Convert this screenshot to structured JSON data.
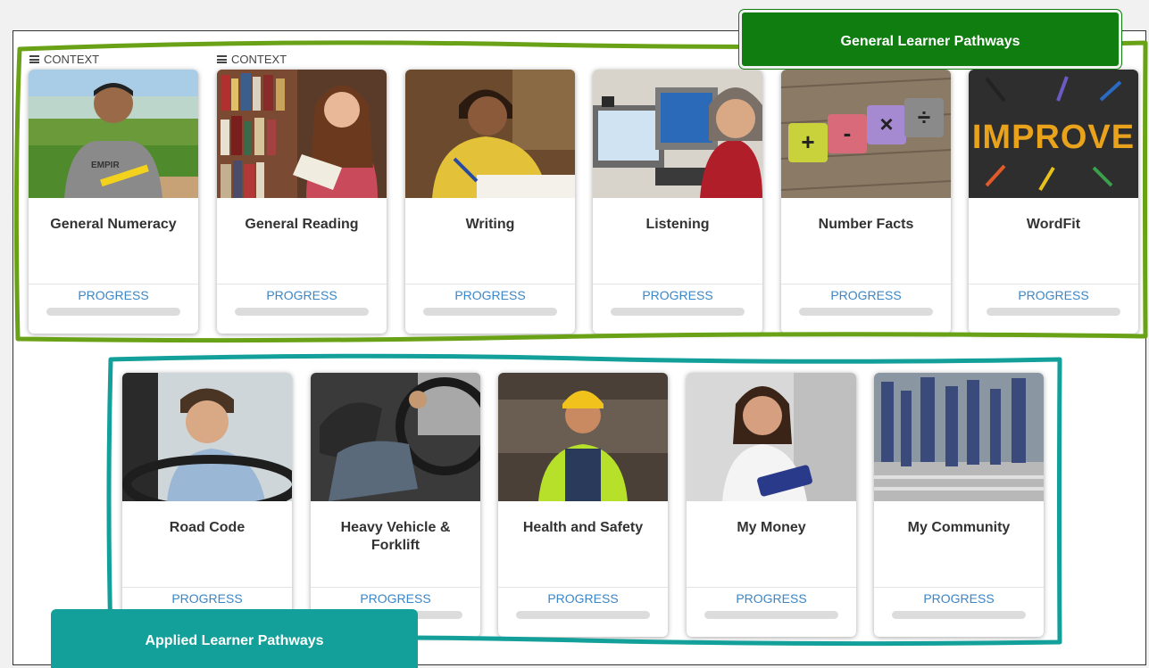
{
  "labels": {
    "general": "General Learner Pathways",
    "applied": "Applied Learner Pathways"
  },
  "context_label": "CONTEXT",
  "general_cards": [
    {
      "title": "General Numeracy",
      "progress_label": "PROGRESS",
      "progress": 0
    },
    {
      "title": "General Reading",
      "progress_label": "PROGRESS",
      "progress": 0
    },
    {
      "title": "Writing",
      "progress_label": "PROGRESS",
      "progress": 0
    },
    {
      "title": "Listening",
      "progress_label": "PROGRESS",
      "progress": 0
    },
    {
      "title": "Number Facts",
      "progress_label": "PROGRESS",
      "progress": 0
    },
    {
      "title": "WordFit",
      "progress_label": "PROGRESS",
      "progress": 0
    }
  ],
  "applied_cards": [
    {
      "title": "Road Code",
      "progress_label": "PROGRESS",
      "progress": 0
    },
    {
      "title": "Heavy Vehicle & Forklift",
      "progress_label": "PROGRESS",
      "progress": 0
    },
    {
      "title": "Health and Safety",
      "progress_label": "PROGRESS",
      "progress": 0
    },
    {
      "title": "My Money",
      "progress_label": "PROGRESS",
      "progress": 0
    },
    {
      "title": "My Community",
      "progress_label": "PROGRESS",
      "progress": 0
    }
  ],
  "improve_image_text": "IMPROVE",
  "cube_symbols": [
    "+",
    "-",
    "×",
    "÷"
  ],
  "colors": {
    "general_accent": "#0f7d0f",
    "general_outline": "#6aa217",
    "applied_accent": "#13a09a",
    "progress_text": "#3b86c6"
  }
}
